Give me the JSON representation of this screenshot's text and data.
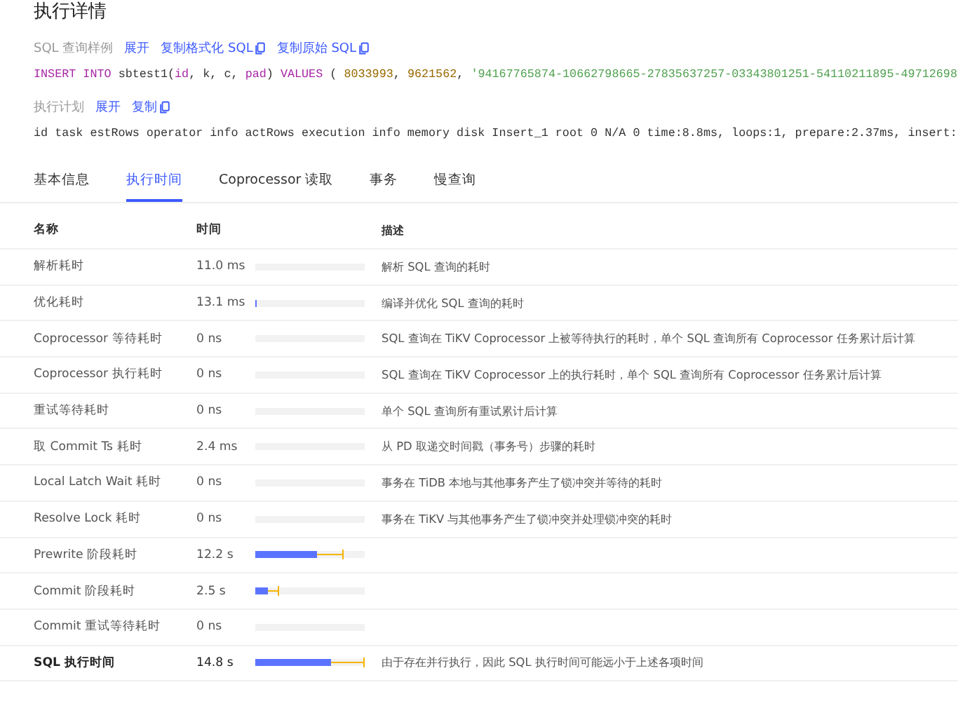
{
  "title": "执行详情",
  "sql_sample": {
    "label": "SQL 查询样例",
    "actions": [
      {
        "label": "展开",
        "kind": "expand"
      },
      {
        "label": "复制格式化 SQL",
        "kind": "copy"
      },
      {
        "label": "复制原始 SQL",
        "kind": "copy"
      }
    ],
    "code": [
      {
        "kind": "keyword",
        "text": "INSERT INTO"
      },
      {
        "kind": "plain",
        "text": " sbtest1("
      },
      {
        "kind": "keyword",
        "text": "id"
      },
      {
        "kind": "plain",
        "text": ", k, c, "
      },
      {
        "kind": "keyword",
        "text": "pad"
      },
      {
        "kind": "plain",
        "text": ") "
      },
      {
        "kind": "keyword",
        "text": "VALUES"
      },
      {
        "kind": "plain",
        "text": " ( "
      },
      {
        "kind": "number",
        "text": "8033993"
      },
      {
        "kind": "plain",
        "text": ", "
      },
      {
        "kind": "number",
        "text": "9621562"
      },
      {
        "kind": "plain",
        "text": ", "
      },
      {
        "kind": "string",
        "text": "'94167765874-10662798665-27835637257-03343801251-54110211895-49712698"
      }
    ]
  },
  "plan": {
    "label": "执行计划",
    "actions": [
      {
        "label": "展开",
        "kind": "expand"
      },
      {
        "label": "复制",
        "kind": "copy"
      }
    ],
    "code": "id task estRows operator info actRows execution info memory disk Insert_1 root 0 N/A 0 time:8.8ms, loops:1, prepare:2.37ms, insert:"
  },
  "tabs": [
    {
      "label": "基本信息",
      "selected": false
    },
    {
      "label": "执行时间",
      "selected": true
    },
    {
      "label": "Coprocessor 读取",
      "selected": false
    },
    {
      "label": "事务",
      "selected": false
    },
    {
      "label": "慢查询",
      "selected": false
    }
  ],
  "table": {
    "columns": [
      "名称",
      "时间",
      "描述"
    ],
    "rows": [
      {
        "name": "解析耗时",
        "time": "11.0 ms",
        "fill": {
          "level": 0
        },
        "description": "解析 SQL 查询的耗时",
        "bold": false
      },
      {
        "name": "优化耗时",
        "time": "13.1 ms",
        "fill": {
          "level": 0.01
        },
        "description": "编译并优化 SQL 查询的耗时",
        "bold": false
      },
      {
        "name": "Coprocessor 等待耗时",
        "time": "0 ns",
        "fill": {
          "level": 0
        },
        "description": "SQL 查询在 TiKV Coprocessor 上被等待执行的耗时，单个 SQL 查询所有 Coprocessor 任务累计后计算",
        "bold": false
      },
      {
        "name": "Coprocessor 执行耗时",
        "time": "0 ns",
        "fill": {
          "level": 0
        },
        "description": "SQL 查询在 TiKV Coprocessor 上的执行耗时，单个 SQL 查询所有 Coprocessor 任务累计后计算",
        "bold": false
      },
      {
        "name": "重试等待耗时",
        "time": "0 ns",
        "fill": {
          "level": 0
        },
        "description": "单个 SQL 查询所有重试累计后计算",
        "bold": false
      },
      {
        "name": "取 Commit Ts 耗时",
        "time": "2.4 ms",
        "fill": {
          "level": 0
        },
        "description": "从 PD 取递交时间戳（事务号）步骤的耗时",
        "bold": false
      },
      {
        "name": "Local Latch Wait 耗时",
        "time": "0 ns",
        "fill": {
          "level": 0
        },
        "description": "事务在 TiDB 本地与其他事务产生了锁冲突并等待的耗时",
        "bold": false
      },
      {
        "name": "Resolve Lock 耗时",
        "time": "0 ns",
        "fill": {
          "level": 0
        },
        "description": "事务在 TiKV 与其他事务产生了锁冲突并处理锁冲突的耗时",
        "bold": false
      },
      {
        "name": "Prewrite 阶段耗时",
        "time": "12.2 s",
        "fill": {
          "level": 0.57
        },
        "whisker": {
          "level": 0.81
        },
        "bold": false
      },
      {
        "name": "Commit 阶段耗时",
        "time": "2.5 s",
        "fill": {
          "level": 0.11
        },
        "whisker": {
          "level": 0.22
        },
        "bold": false
      },
      {
        "name": "Commit 重试等待耗时",
        "time": "0 ns",
        "fill": {
          "level": 0
        },
        "bold": false
      },
      {
        "name": "SQL 执行时间",
        "time": "14.8 s",
        "fill": {
          "level": 0.69
        },
        "whisker": {
          "level": 1.0
        },
        "description": "由于存在并行执行，因此 SQL 执行时间可能远小于上述各项时间",
        "bold": true
      }
    ]
  }
}
